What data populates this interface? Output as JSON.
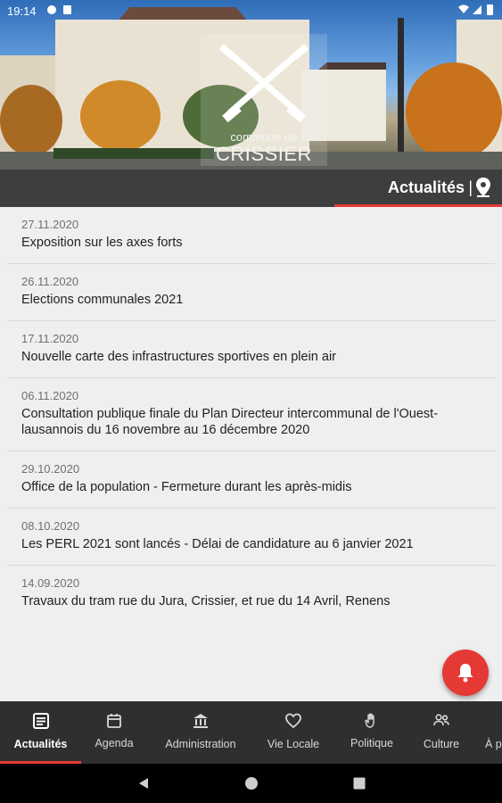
{
  "status_bar": {
    "time": "19:14"
  },
  "header": {
    "logo_small": "commune de",
    "logo_big": "CRISSIER"
  },
  "topbar": {
    "title": "Actualités",
    "separator": "|",
    "location_icon": "location-pin-icon",
    "accent_color": "#e53935"
  },
  "news": [
    {
      "date": "27.11.2020",
      "title": "Exposition sur les axes forts"
    },
    {
      "date": "26.11.2020",
      "title": "Elections communales 2021"
    },
    {
      "date": "17.11.2020",
      "title": "Nouvelle carte des infrastructures sportives en plein air"
    },
    {
      "date": "06.11.2020",
      "title": "Consultation publique finale du Plan Directeur intercommunal de l'Ouest-lausannois du 16 novembre au 16 décembre 2020"
    },
    {
      "date": "29.10.2020",
      "title": "Office de la population - Fermeture durant les après-midis"
    },
    {
      "date": "08.10.2020",
      "title": "Les PERL 2021 sont lancés - Délai de candidature au 6 janvier 2021"
    },
    {
      "date": "14.09.2020",
      "title": "Travaux du tram rue du Jura, Crissier, et rue du 14 Avril, Renens"
    }
  ],
  "fab": {
    "icon": "bell-icon"
  },
  "bottom_nav": [
    {
      "label": "Actualités",
      "icon": "newspaper-icon",
      "active": true
    },
    {
      "label": "Agenda",
      "icon": "calendar-icon"
    },
    {
      "label": "Administration",
      "icon": "building-icon"
    },
    {
      "label": "Vie Locale",
      "icon": "heart-icon"
    },
    {
      "label": "Politique",
      "icon": "hand-icon"
    },
    {
      "label": "Culture",
      "icon": "people-icon"
    },
    {
      "label": "À p",
      "icon": "more-icon"
    }
  ]
}
